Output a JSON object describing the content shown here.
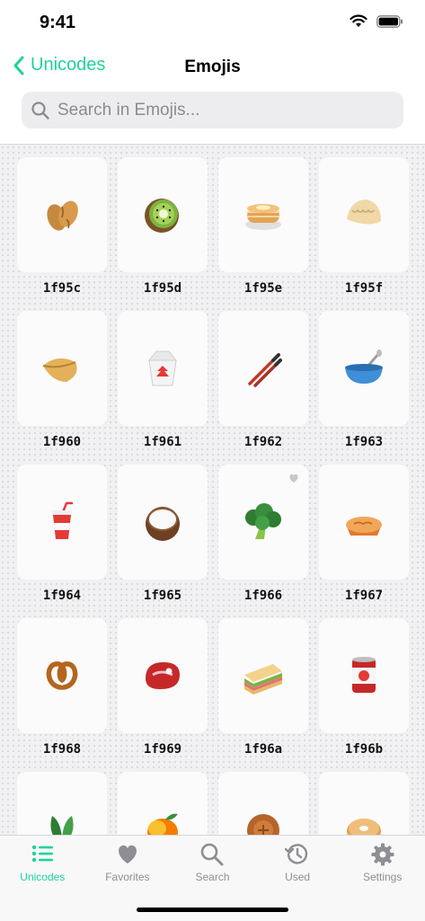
{
  "status": {
    "time": "9:41"
  },
  "nav": {
    "back_label": "Unicodes",
    "title": "Emojis"
  },
  "search": {
    "placeholder": "Search in Emojis..."
  },
  "emojis": [
    {
      "code": "1f95c",
      "name": "peanuts-icon",
      "favorite": false
    },
    {
      "code": "1f95d",
      "name": "kiwi-icon",
      "favorite": false
    },
    {
      "code": "1f95e",
      "name": "pancakes-icon",
      "favorite": false
    },
    {
      "code": "1f95f",
      "name": "dumpling-icon",
      "favorite": false
    },
    {
      "code": "1f960",
      "name": "fortune-cookie-icon",
      "favorite": false
    },
    {
      "code": "1f961",
      "name": "takeout-box-icon",
      "favorite": false
    },
    {
      "code": "1f962",
      "name": "chopsticks-icon",
      "favorite": false
    },
    {
      "code": "1f963",
      "name": "bowl-with-spoon-icon",
      "favorite": false
    },
    {
      "code": "1f964",
      "name": "cup-with-straw-icon",
      "favorite": false
    },
    {
      "code": "1f965",
      "name": "coconut-icon",
      "favorite": false
    },
    {
      "code": "1f966",
      "name": "broccoli-icon",
      "favorite": true
    },
    {
      "code": "1f967",
      "name": "pie-icon",
      "favorite": false
    },
    {
      "code": "1f968",
      "name": "pretzel-icon",
      "favorite": false
    },
    {
      "code": "1f969",
      "name": "cut-of-meat-icon",
      "favorite": false
    },
    {
      "code": "1f96a",
      "name": "sandwich-icon",
      "favorite": false
    },
    {
      "code": "1f96b",
      "name": "canned-food-icon",
      "favorite": false
    },
    {
      "code": "",
      "name": "leafy-green-icon",
      "favorite": false
    },
    {
      "code": "",
      "name": "mango-icon",
      "favorite": false
    },
    {
      "code": "",
      "name": "moon-cake-icon",
      "favorite": false
    },
    {
      "code": "",
      "name": "bagel-icon",
      "favorite": false
    }
  ],
  "tabs": [
    {
      "label": "Unicodes",
      "icon": "list-icon",
      "active": true
    },
    {
      "label": "Favorites",
      "icon": "heart-icon",
      "active": false
    },
    {
      "label": "Search",
      "icon": "search-icon",
      "active": false
    },
    {
      "label": "Used",
      "icon": "history-icon",
      "active": false
    },
    {
      "label": "Settings",
      "icon": "gear-icon",
      "active": false
    }
  ],
  "colors": {
    "accent": "#1fd39a",
    "inactive": "#8e8e93",
    "tile": "#fbfbfc",
    "grid_bg": "#f1f1f3"
  }
}
